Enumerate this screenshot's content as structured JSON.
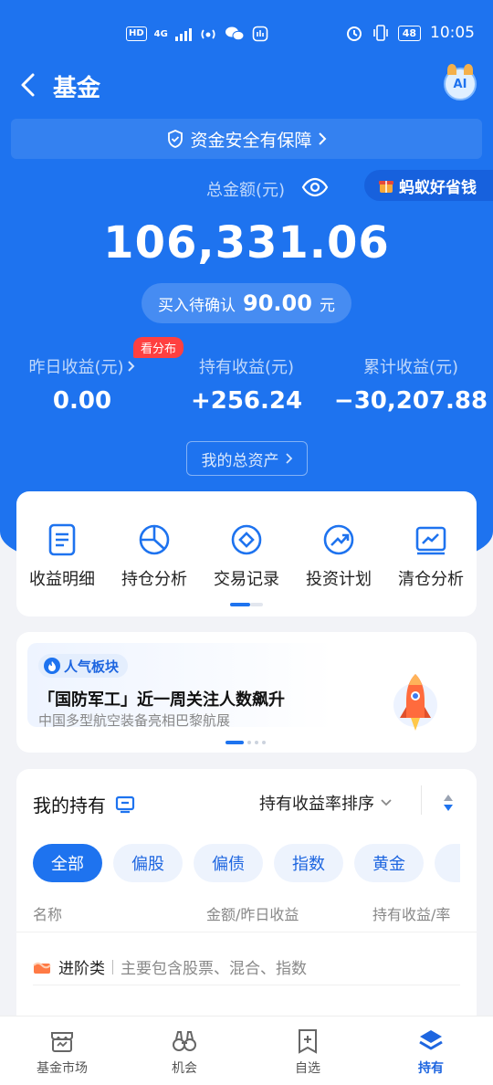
{
  "status_bar": {
    "hd": "HD",
    "net": "4G",
    "time": "10:05",
    "battery": "48"
  },
  "nav": {
    "title": "基金",
    "ai_label": "AI"
  },
  "safety_banner": "资金安全有保障",
  "total": {
    "label": "总金额(元)",
    "amount": "106,331.06",
    "pending_label": "买入待确认",
    "pending_amount": "90.00",
    "pending_unit": "元"
  },
  "promo": "蚂蚁好省钱",
  "stats": {
    "yesterday_label": "昨日收益(元)",
    "yesterday_value": "0.00",
    "badge": "看分布",
    "holding_label": "持有收益(元)",
    "holding_value": "+256.24",
    "cumulative_label": "累计收益(元)",
    "cumulative_value": "−30,207.88"
  },
  "my_assets": "我的总资产",
  "quick_menu": [
    {
      "label": "收益明细",
      "icon": "document-icon"
    },
    {
      "label": "持仓分析",
      "icon": "pie-chart-icon"
    },
    {
      "label": "交易记录",
      "icon": "diamond-circle-icon"
    },
    {
      "label": "投资计划",
      "icon": "trend-up-icon"
    },
    {
      "label": "清仓分析",
      "icon": "line-chart-icon"
    }
  ],
  "banner": {
    "tag": "人气板块",
    "title": "「国防军工」近一周关注人数飙升",
    "subtitle": "中国多型航空装备亮相巴黎航展"
  },
  "holdings": {
    "title": "我的持有",
    "sort_label": "持有收益率排序",
    "chips": [
      "全部",
      "偏股",
      "偏债",
      "指数",
      "黄金"
    ],
    "columns": {
      "name": "名称",
      "amount": "金额/昨日收益",
      "return": "持有收益/率"
    },
    "category": {
      "name": "进阶类",
      "desc": "主要包含股票、混合、指数"
    }
  },
  "tabbar": [
    {
      "label": "基金市场",
      "icon": "market-icon"
    },
    {
      "label": "机会",
      "icon": "binoculars-icon"
    },
    {
      "label": "自选",
      "icon": "add-square-icon"
    },
    {
      "label": "持有",
      "icon": "layers-icon"
    }
  ],
  "colors": {
    "primary": "#1e73ef",
    "accent_red": "#ff4040"
  }
}
